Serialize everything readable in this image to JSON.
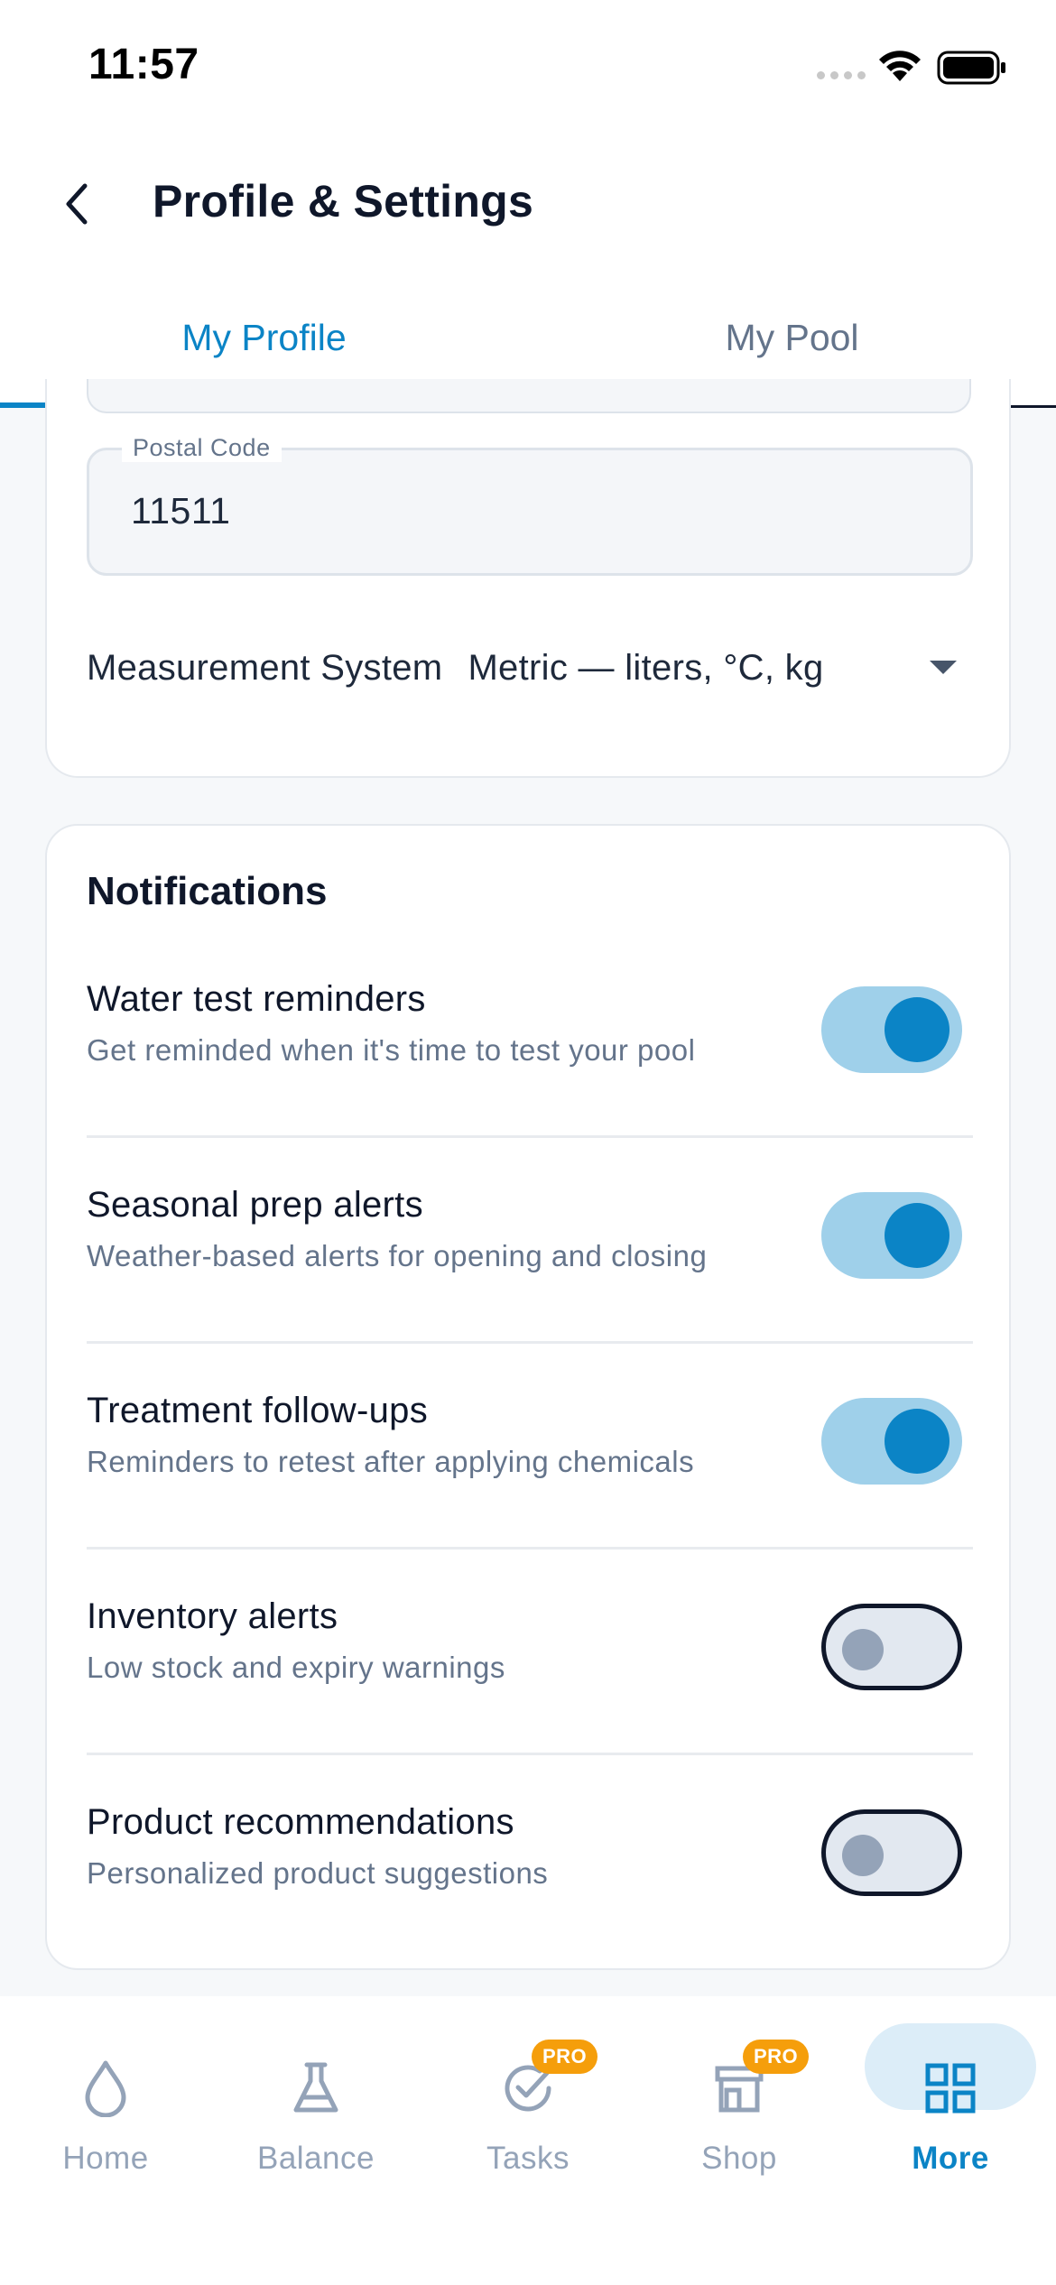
{
  "status_bar": {
    "time": "11:57"
  },
  "header": {
    "title": "Profile & Settings",
    "back_icon": "chevron-left-icon"
  },
  "tabs": [
    {
      "label": "My Profile",
      "active": true
    },
    {
      "label": "My Pool",
      "active": false
    }
  ],
  "profile": {
    "postal_code_label": "Postal Code",
    "postal_code_value": "11511",
    "measurement_label": "Measurement System",
    "measurement_value": "Metric — liters, °C, kg"
  },
  "notifications": {
    "title": "Notifications",
    "items": [
      {
        "name": "Water test reminders",
        "description": "Get reminded when it's time to test your pool",
        "enabled": true
      },
      {
        "name": "Seasonal prep alerts",
        "description": "Weather-based alerts for opening and closing",
        "enabled": true
      },
      {
        "name": "Treatment follow-ups",
        "description": "Reminders to retest after applying chemicals",
        "enabled": true
      },
      {
        "name": "Inventory alerts",
        "description": "Low stock and expiry warnings",
        "enabled": false
      },
      {
        "name": "Product recommendations",
        "description": "Personalized product suggestions",
        "enabled": false
      }
    ]
  },
  "bottom_nav": {
    "items": [
      {
        "label": "Home",
        "icon": "droplet-icon",
        "active": false
      },
      {
        "label": "Balance",
        "icon": "flask-icon",
        "active": false
      },
      {
        "label": "Tasks",
        "icon": "check-circle-icon",
        "active": false,
        "badge": "PRO"
      },
      {
        "label": "Shop",
        "icon": "store-icon",
        "active": false,
        "badge": "PRO"
      },
      {
        "label": "More",
        "icon": "grid-icon",
        "active": true
      }
    ]
  },
  "colors": {
    "accent": "#0b84c6",
    "toggle_on_track": "#9fd0ea",
    "pro_badge": "#f59e0b",
    "muted_text": "#64748b"
  }
}
